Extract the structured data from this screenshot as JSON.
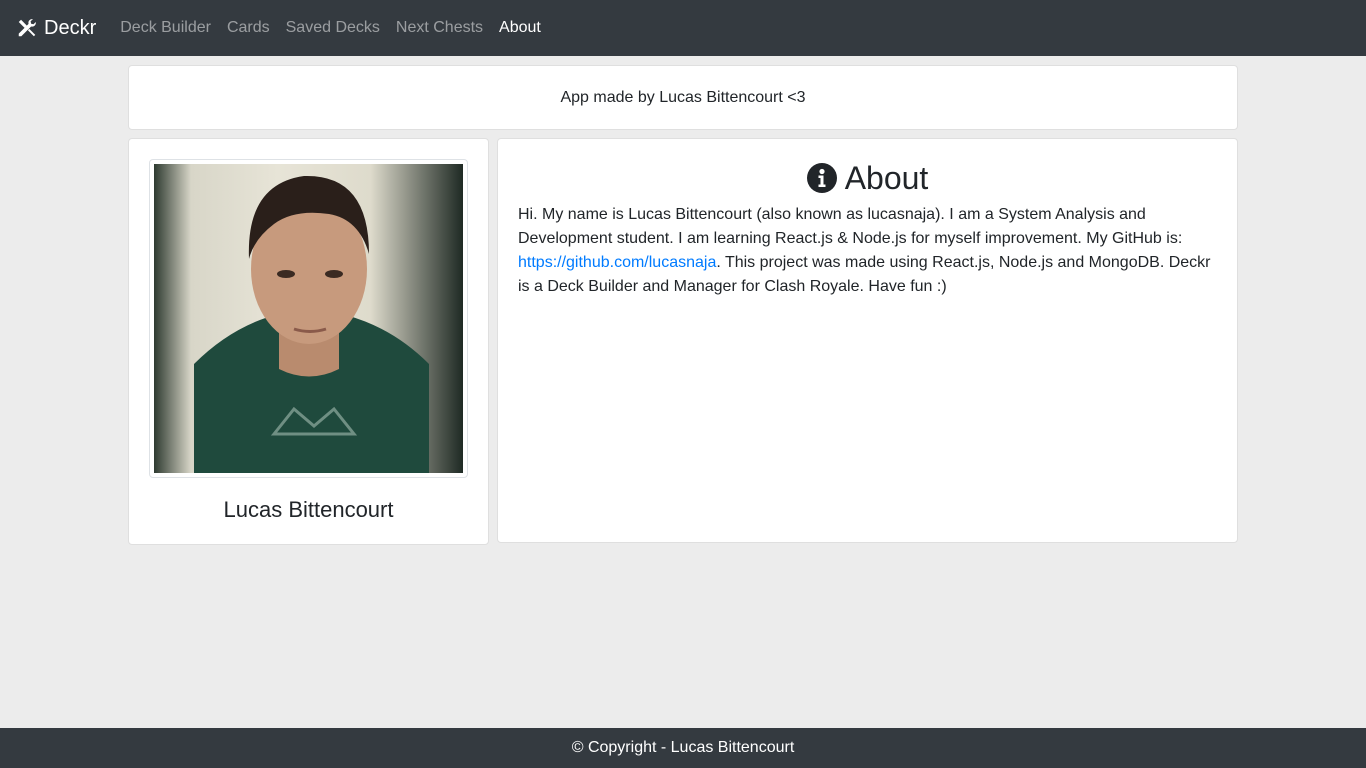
{
  "navbar": {
    "brand_icon": "tools-icon",
    "brand": "Deckr",
    "links": [
      {
        "label": "Deck Builder",
        "active": false
      },
      {
        "label": "Cards",
        "active": false
      },
      {
        "label": "Saved Decks",
        "active": false
      },
      {
        "label": "Next Chests",
        "active": false
      },
      {
        "label": "About",
        "active": true
      }
    ]
  },
  "banner": {
    "text": "App made by Lucas Bittencourt <3"
  },
  "profile": {
    "name": "Lucas Bittencourt"
  },
  "about": {
    "icon": "info-circle-icon",
    "title": "About",
    "text_before_link": "Hi. My name is Lucas Bittencourt (also known as lucasnaja). I am a System Analysis and Development student. I am learning React.js & Node.js for myself improvement. My GitHub is: ",
    "link": "https://github.com/lucasnaja",
    "text_after_link": ". This project was made using React.js, Node.js and MongoDB. Deckr is a Deck Builder and Manager for Clash Royale. Have fun :)"
  },
  "footer": {
    "text": "© Copyright - Lucas Bittencourt"
  },
  "colors": {
    "navbar_bg": "#343a40",
    "page_bg": "#ececec",
    "link": "#007bff"
  }
}
